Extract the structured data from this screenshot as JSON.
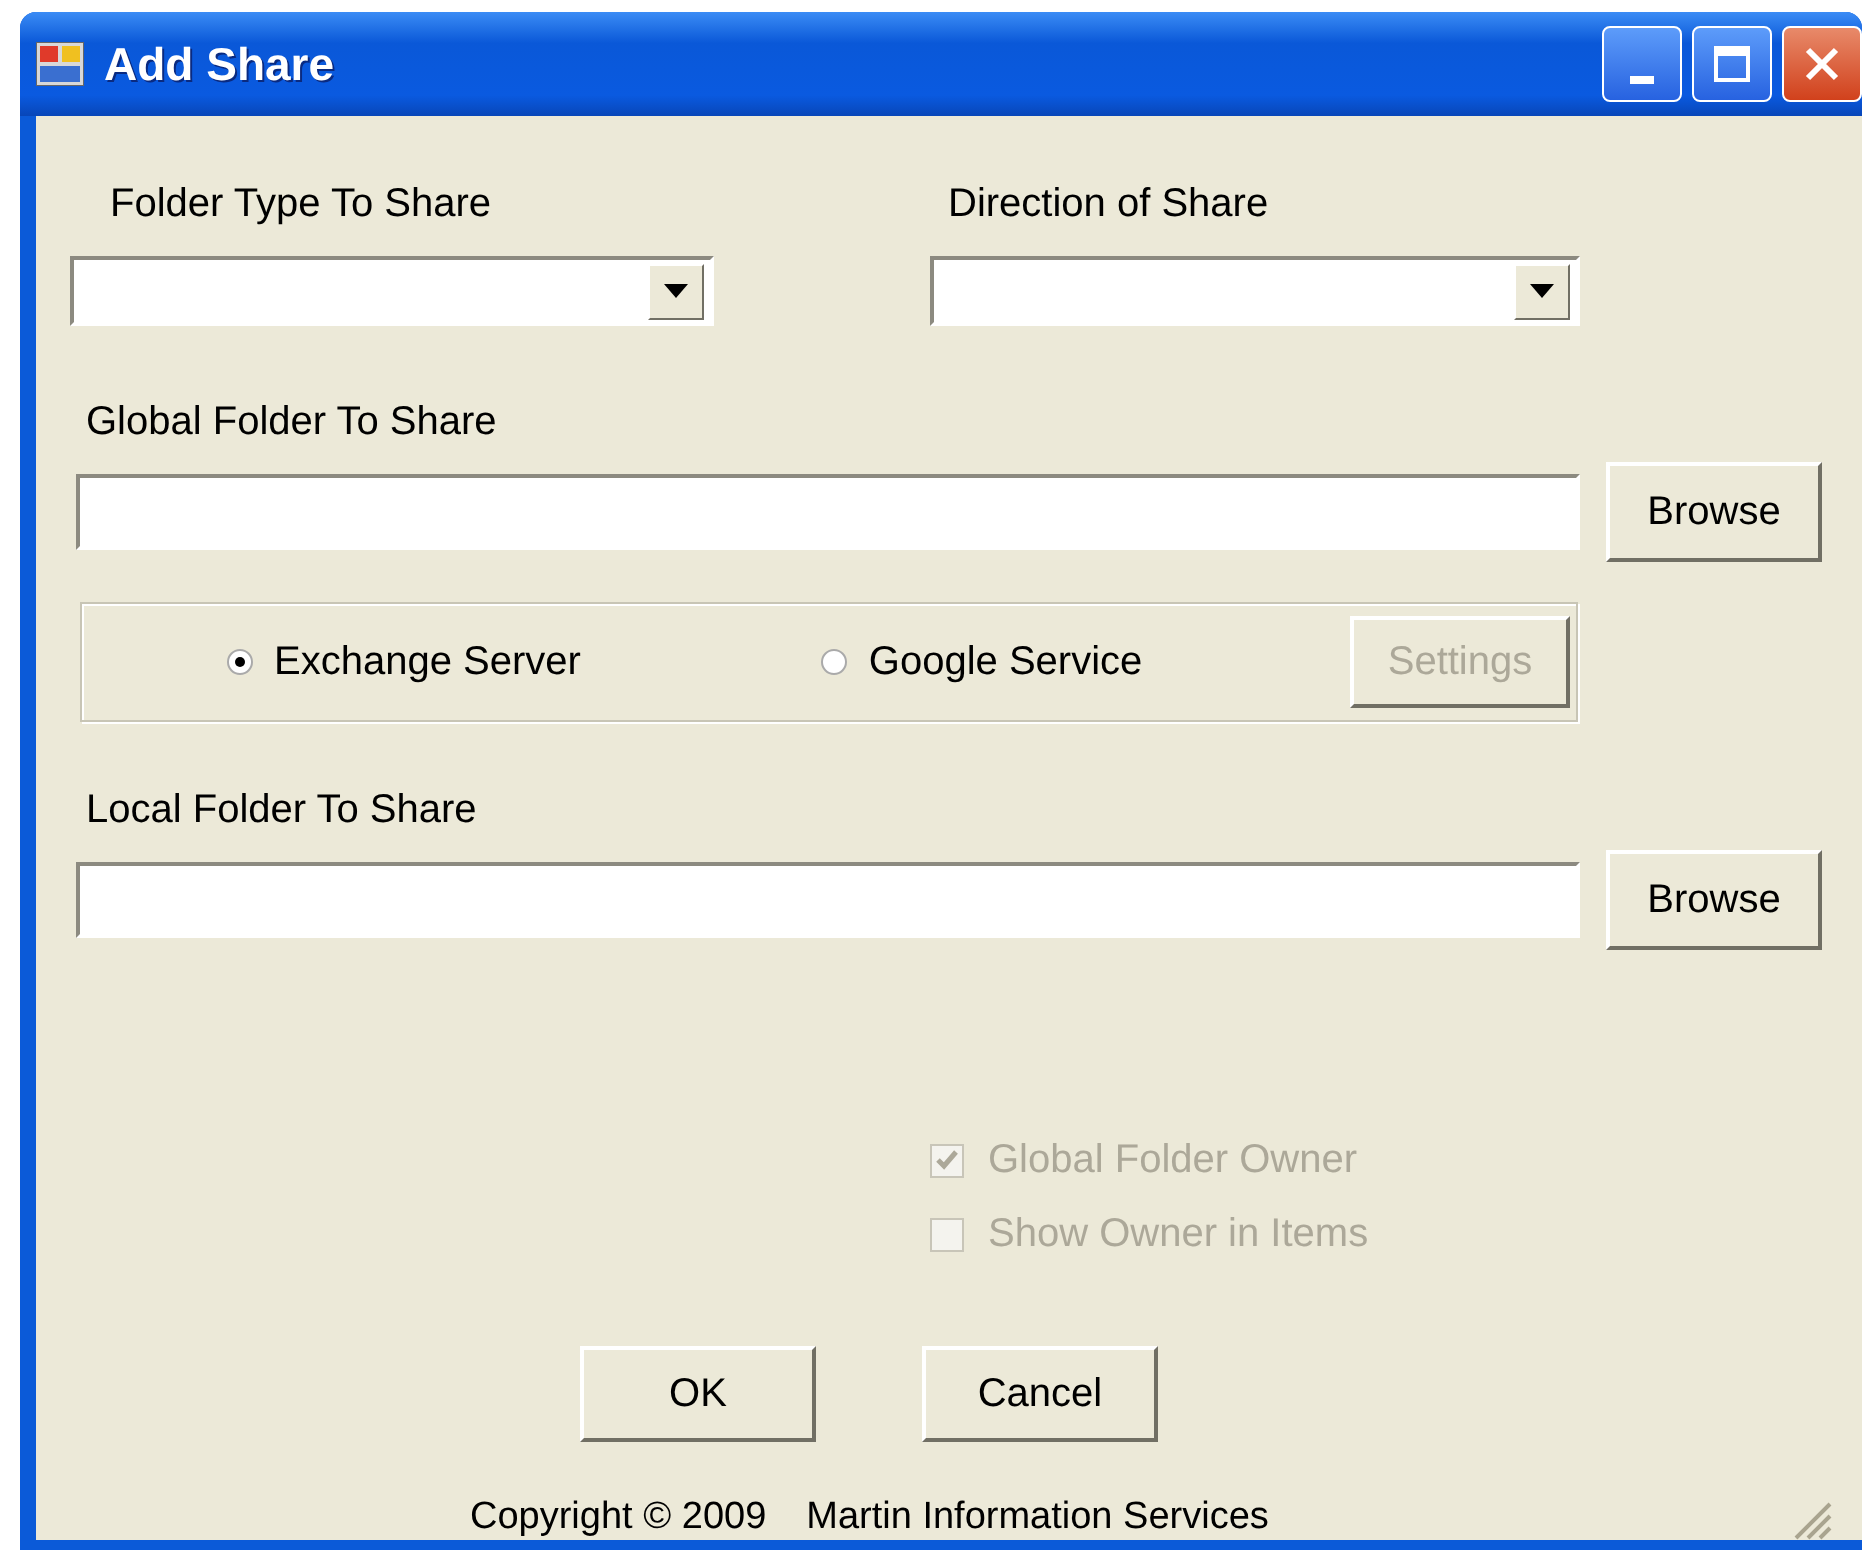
{
  "window": {
    "title": "Add Share"
  },
  "folder_type": {
    "label": "Folder Type To Share"
  },
  "direction": {
    "label": "Direction of Share"
  },
  "global_folder": {
    "label": "Global Folder To Share",
    "browse": "Browse"
  },
  "service": {
    "options": [
      {
        "label": "Exchange Server",
        "selected": true
      },
      {
        "label": "Google Service",
        "selected": false
      }
    ],
    "settings": {
      "label": "Settings",
      "disabled": true
    }
  },
  "local_folder": {
    "label": "Local Folder To Share",
    "browse": "Browse"
  },
  "options": [
    {
      "label": "Global Folder Owner",
      "checked": true,
      "disabled": true
    },
    {
      "label": "Show Owner in Items",
      "checked": false,
      "disabled": true
    }
  ],
  "buttons": [
    "OK",
    "Cancel"
  ],
  "footer": [
    "Copyright © 2009",
    "Martin Information Services"
  ]
}
